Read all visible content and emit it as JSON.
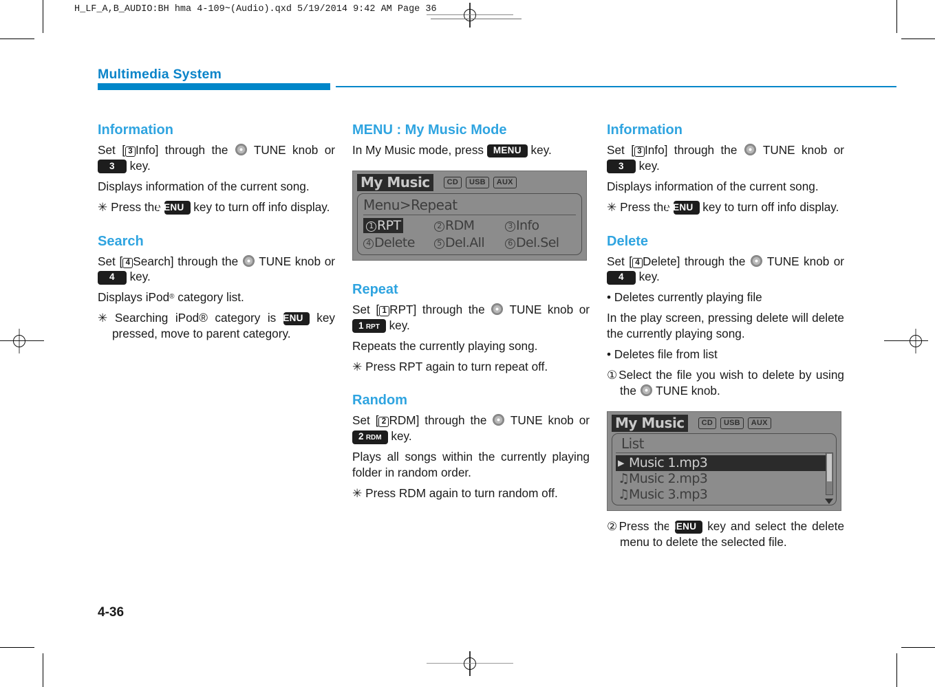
{
  "prepress": {
    "file_stamp": "H_LF_A,B_AUDIO:BH hma 4-109~(Audio).qxd  5/19/2014  9:42 AM  Page 36"
  },
  "running_head": {
    "title": "Multimedia System",
    "accent_color": "#0086c9"
  },
  "folio": {
    "page_number": "4-36"
  },
  "columns": [
    {
      "id": "column-1",
      "sections": [
        {
          "heading": "Information",
          "blocks": [
            {
              "type": "paragraph",
              "parts": [
                {
                  "t": "text",
                  "v": "Set ["
                },
                {
                  "t": "circnum",
                  "v": "3"
                },
                {
                  "t": "text",
                  "v": "Info] through the "
                },
                {
                  "t": "knob",
                  "v": "tune-knob"
                },
                {
                  "t": "text",
                  "v": " TUNE knob or "
                },
                {
                  "t": "keycap",
                  "v": "3"
                },
                {
                  "t": "text",
                  "v": " key."
                }
              ]
            },
            {
              "type": "paragraph",
              "parts": [
                {
                  "t": "text",
                  "v": "Displays information of the current song."
                }
              ]
            },
            {
              "type": "hanging",
              "parts": [
                {
                  "t": "text",
                  "v": "✳ Press the "
                },
                {
                  "t": "keycap",
                  "v": "MENU"
                },
                {
                  "t": "text",
                  "v": " key to turn off info display."
                }
              ]
            }
          ]
        },
        {
          "heading": "Search",
          "blocks": [
            {
              "type": "paragraph",
              "parts": [
                {
                  "t": "text",
                  "v": "Set ["
                },
                {
                  "t": "circnum",
                  "v": "4"
                },
                {
                  "t": "text",
                  "v": "Search] through the "
                },
                {
                  "t": "knob",
                  "v": "tune-knob"
                },
                {
                  "t": "text",
                  "v": " TUNE knob or "
                },
                {
                  "t": "keycap",
                  "v": "4"
                },
                {
                  "t": "text",
                  "v": " key."
                }
              ]
            },
            {
              "type": "paragraph",
              "parts": [
                {
                  "t": "text",
                  "v": "Displays iPod"
                },
                {
                  "t": "sup",
                  "v": "®"
                },
                {
                  "t": "text",
                  "v": " category list."
                }
              ]
            },
            {
              "type": "hanging",
              "parts": [
                {
                  "t": "text",
                  "v": "✳ Searching iPod® category is "
                },
                {
                  "t": "keycap",
                  "v": "MENU"
                },
                {
                  "t": "text",
                  "v": " key pressed, move to parent category."
                }
              ]
            }
          ]
        }
      ]
    },
    {
      "id": "column-2",
      "sections": [
        {
          "heading": "MENU : My Music Mode",
          "blocks": [
            {
              "type": "paragraph",
              "parts": [
                {
                  "t": "text",
                  "v": "In My Music mode, press "
                },
                {
                  "t": "keycap",
                  "v": "MENU"
                },
                {
                  "t": "text",
                  "v": " key."
                }
              ]
            },
            {
              "type": "lcd-menu",
              "ref": "lcd_menu"
            }
          ]
        },
        {
          "heading": "Repeat",
          "blocks": [
            {
              "type": "paragraph",
              "parts": [
                {
                  "t": "text",
                  "v": "Set ["
                },
                {
                  "t": "circnum",
                  "v": "1"
                },
                {
                  "t": "text",
                  "v": "RPT] through the "
                },
                {
                  "t": "knob",
                  "v": "tune-knob"
                },
                {
                  "t": "text",
                  "v": " TUNE knob or "
                },
                {
                  "t": "keycap2",
                  "v": "1",
                  "sub": "RPT"
                },
                {
                  "t": "text",
                  "v": " key."
                }
              ]
            },
            {
              "type": "paragraph",
              "parts": [
                {
                  "t": "text",
                  "v": "Repeats the currently playing song."
                }
              ]
            },
            {
              "type": "hanging",
              "parts": [
                {
                  "t": "text",
                  "v": "✳ Press RPT again to turn repeat off."
                }
              ]
            }
          ]
        },
        {
          "heading": "Random",
          "blocks": [
            {
              "type": "paragraph",
              "parts": [
                {
                  "t": "text",
                  "v": "Set ["
                },
                {
                  "t": "circnum",
                  "v": "2"
                },
                {
                  "t": "text",
                  "v": "RDM] through the "
                },
                {
                  "t": "knob",
                  "v": "tune-knob"
                },
                {
                  "t": "text",
                  "v": " TUNE knob or "
                },
                {
                  "t": "keycap2",
                  "v": "2",
                  "sub": "RDM"
                },
                {
                  "t": "text",
                  "v": " key."
                }
              ]
            },
            {
              "type": "paragraph",
              "parts": [
                {
                  "t": "text",
                  "v": "Plays all songs within the currently playing folder in random order."
                }
              ]
            },
            {
              "type": "hanging",
              "parts": [
                {
                  "t": "text",
                  "v": "✳ Press RDM again to turn random off."
                }
              ]
            }
          ]
        }
      ]
    },
    {
      "id": "column-3",
      "sections": [
        {
          "heading": "Information",
          "blocks": [
            {
              "type": "paragraph",
              "parts": [
                {
                  "t": "text",
                  "v": "Set ["
                },
                {
                  "t": "circnum",
                  "v": "3"
                },
                {
                  "t": "text",
                  "v": "Info] through the "
                },
                {
                  "t": "knob",
                  "v": "tune-knob"
                },
                {
                  "t": "text",
                  "v": " TUNE knob or "
                },
                {
                  "t": "keycap",
                  "v": "3"
                },
                {
                  "t": "text",
                  "v": " key."
                }
              ]
            },
            {
              "type": "paragraph",
              "parts": [
                {
                  "t": "text",
                  "v": "Displays information of the current song."
                }
              ]
            },
            {
              "type": "hanging",
              "parts": [
                {
                  "t": "text",
                  "v": "✳ Press the "
                },
                {
                  "t": "keycap",
                  "v": "MENU"
                },
                {
                  "t": "text",
                  "v": " key to turn off info display."
                }
              ]
            }
          ]
        },
        {
          "heading": "Delete",
          "blocks": [
            {
              "type": "paragraph",
              "parts": [
                {
                  "t": "text",
                  "v": "Set ["
                },
                {
                  "t": "circnum",
                  "v": "4"
                },
                {
                  "t": "text",
                  "v": "Delete] through the "
                },
                {
                  "t": "knob",
                  "v": "tune-knob"
                },
                {
                  "t": "text",
                  "v": " TUNE knob or "
                },
                {
                  "t": "keycap",
                  "v": "4"
                },
                {
                  "t": "text",
                  "v": " key."
                }
              ]
            },
            {
              "type": "bullet",
              "parts": [
                {
                  "t": "text",
                  "v": "•  Deletes currently playing file"
                }
              ]
            },
            {
              "type": "paragraph",
              "parts": [
                {
                  "t": "text",
                  "v": "In the play screen, pressing delete will delete the currently playing song."
                }
              ]
            },
            {
              "type": "bullet",
              "parts": [
                {
                  "t": "text",
                  "v": "•  Deletes file from list"
                }
              ]
            },
            {
              "type": "hanging-num",
              "parts": [
                {
                  "t": "text",
                  "v": "①Select the file you wish to delete by using the "
                },
                {
                  "t": "knob",
                  "v": "tune-knob"
                },
                {
                  "t": "text",
                  "v": " TUNE knob."
                }
              ]
            },
            {
              "type": "lcd-list",
              "ref": "lcd_list"
            },
            {
              "type": "hanging-num",
              "parts": [
                {
                  "t": "text",
                  "v": "②Press the "
                },
                {
                  "t": "keycap",
                  "v": "MENU"
                },
                {
                  "t": "text",
                  "v": " key and select the delete menu to delete the selected file."
                }
              ]
            }
          ]
        }
      ]
    }
  ],
  "lcd_menu": {
    "title": "My Music",
    "sources": [
      "CD",
      "USB",
      "AUX"
    ],
    "breadcrumb": "Menu>Repeat",
    "items": [
      {
        "num": "1",
        "label": "RPT",
        "selected": true
      },
      {
        "num": "2",
        "label": "RDM",
        "selected": false
      },
      {
        "num": "3",
        "label": "Info",
        "selected": false
      },
      {
        "num": "4",
        "label": "Delete",
        "selected": false
      },
      {
        "num": "5",
        "label": "Del.All",
        "selected": false
      },
      {
        "num": "6",
        "label": "Del.Sel",
        "selected": false
      }
    ]
  },
  "lcd_list": {
    "title": "My Music",
    "sources": [
      "CD",
      "USB",
      "AUX"
    ],
    "header": "List",
    "rows": [
      {
        "icon": "▸",
        "label": "Music 1.mp3",
        "selected": true
      },
      {
        "icon": "♫",
        "label": "Music 2.mp3",
        "selected": false
      },
      {
        "icon": "♫",
        "label": "Music 3.mp3",
        "selected": false
      }
    ]
  }
}
